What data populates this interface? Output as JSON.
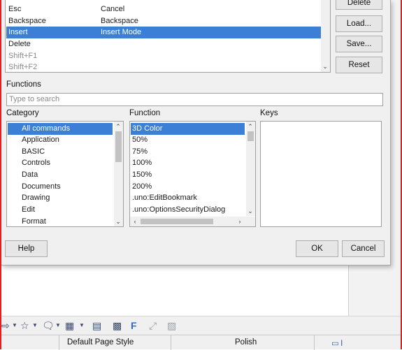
{
  "shortcuts": {
    "rows": [
      {
        "key": "Esc",
        "command": "Cancel"
      },
      {
        "key": "Backspace",
        "command": "Backspace"
      },
      {
        "key": "Insert",
        "command": "Insert Mode",
        "selected": true
      },
      {
        "key": "Delete",
        "command": ""
      },
      {
        "key": "Shift+F1",
        "command": ""
      },
      {
        "key": "Shift+F2",
        "command": ""
      }
    ]
  },
  "side_buttons": {
    "delete": "Delete",
    "load": "Load...",
    "save": "Save...",
    "reset": "Reset"
  },
  "functions": {
    "section_label": "Functions",
    "search_placeholder": "Type to search",
    "category_label": "Category",
    "function_label": "Function",
    "keys_label": "Keys",
    "categories": [
      "All commands",
      "Application",
      "BASIC",
      "Controls",
      "Data",
      "Documents",
      "Drawing",
      "Edit",
      "Format"
    ],
    "functions": [
      "3D Color",
      "50%",
      "75%",
      "100%",
      "150%",
      "200%",
      ".uno:EditBookmark",
      ".uno:OptionsSecurityDialog"
    ],
    "selected_category": "All commands",
    "selected_function": "3D Color"
  },
  "footer": {
    "help": "Help",
    "ok": "OK",
    "cancel": "Cancel"
  },
  "statusbar": {
    "page_style": "Default Page Style",
    "language": "Polish"
  },
  "toolbar_icons": [
    "arrow-shapes-icon",
    "star-shapes-icon",
    "callout-shapes-icon",
    "frame-icon",
    "insert-caption-icon",
    "text-box-icon",
    "fontwork-icon",
    "points-icon",
    "toggle-extrusion-icon"
  ],
  "colors": {
    "selection": "#3c7fd6",
    "frame": "#e02020"
  }
}
